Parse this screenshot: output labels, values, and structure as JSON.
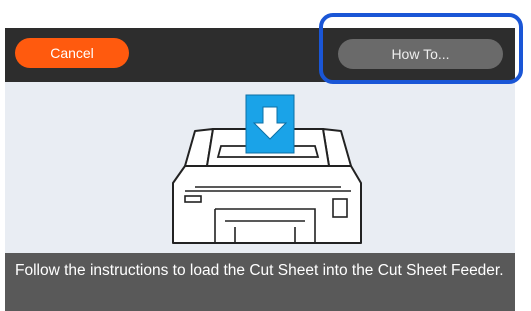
{
  "header": {
    "cancel_label": "Cancel",
    "how_to_label": "How To..."
  },
  "message": {
    "text": "Follow the instructions to load the Cut Sheet into the Cut Sheet Feeder."
  },
  "illustration": {
    "sheet_color": "#1aa3e8",
    "arrow_icon": "arrow-down-icon"
  },
  "colors": {
    "cancel_button": "#ff5a0e",
    "how_to_button": "#6a6a6a",
    "highlight_frame": "#1a56d6",
    "top_bar": "#2d2d2d",
    "message_bar": "#595959",
    "screen_background": "#e9edf3"
  }
}
